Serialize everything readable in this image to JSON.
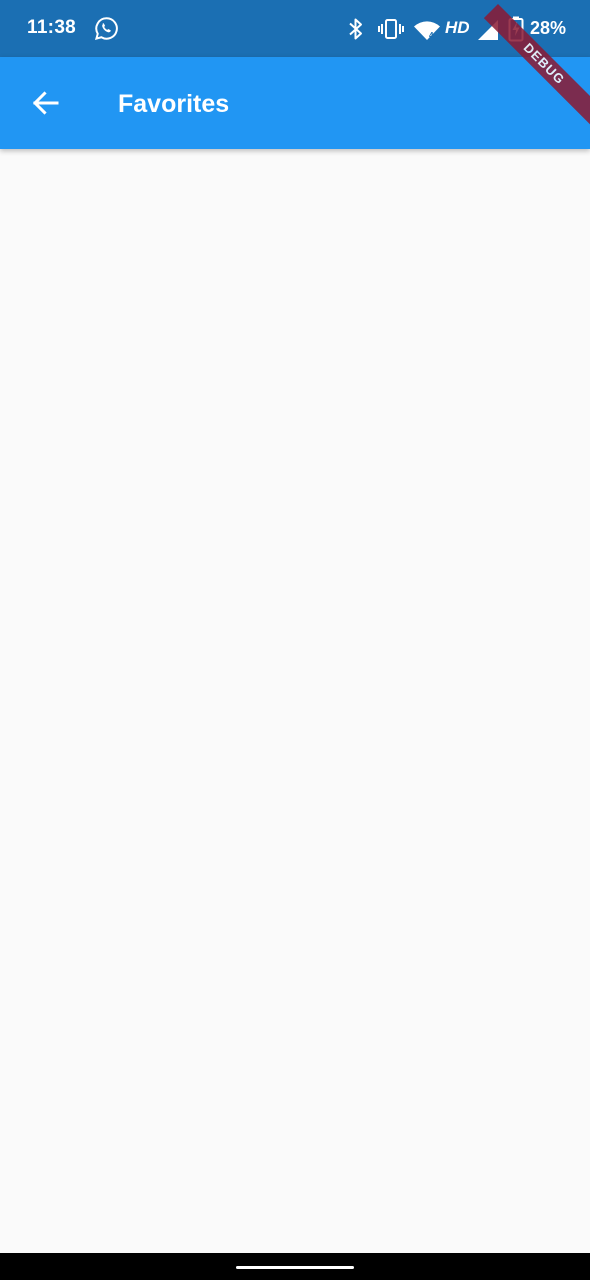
{
  "status_bar": {
    "time": "11:38",
    "network_label": "HD",
    "battery": "28%",
    "icons": [
      "whatsapp-icon",
      "bluetooth-icon",
      "vibrate-icon",
      "wifi-icon",
      "signal-icon",
      "battery-charging-icon"
    ],
    "background": "#1b6fb3"
  },
  "debug_banner": {
    "label": "DEBUG"
  },
  "app_bar": {
    "title": "Favorites",
    "back_icon": "arrow-back-icon",
    "background": "#2196f3"
  },
  "content": {
    "background": "#fafafa"
  }
}
